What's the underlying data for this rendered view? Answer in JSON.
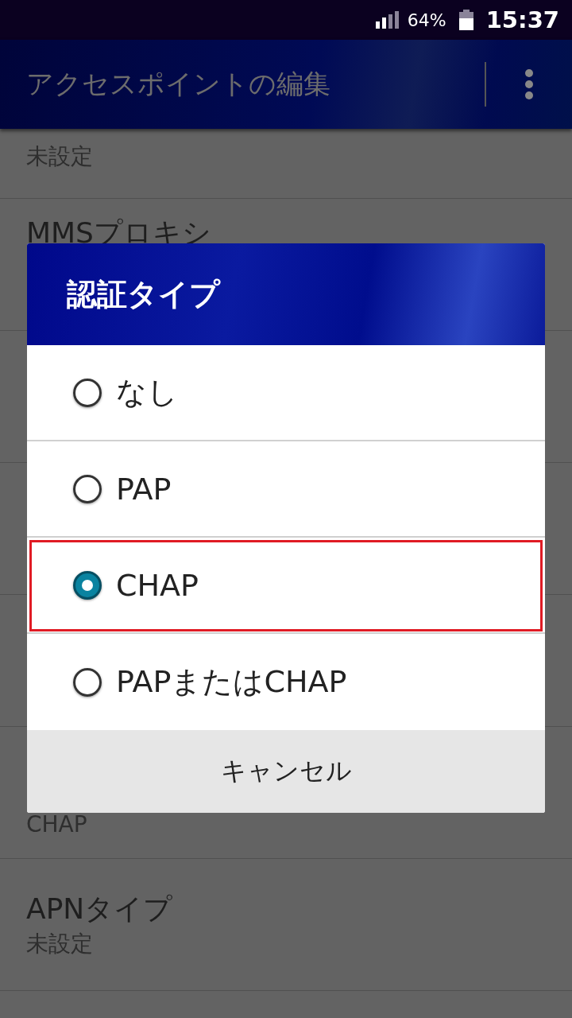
{
  "status_bar": {
    "battery": "64%",
    "time": "15:37"
  },
  "app_bar": {
    "title": "アクセスポイントの編集"
  },
  "background_list": {
    "top_value": "未設定",
    "top_item_title": "MMSプロキシ",
    "lower_items": [
      {
        "value": "CHAP"
      },
      {
        "title": "APNタイプ",
        "value": "未設定"
      }
    ]
  },
  "dialog": {
    "title": "認証タイプ",
    "options": [
      {
        "label": "なし",
        "selected": false,
        "highlighted": false
      },
      {
        "label": "PAP",
        "selected": false,
        "highlighted": false
      },
      {
        "label": "CHAP",
        "selected": true,
        "highlighted": true
      },
      {
        "label": "PAPまたはCHAP",
        "selected": false,
        "highlighted": false
      }
    ],
    "cancel": "キャンセル"
  }
}
